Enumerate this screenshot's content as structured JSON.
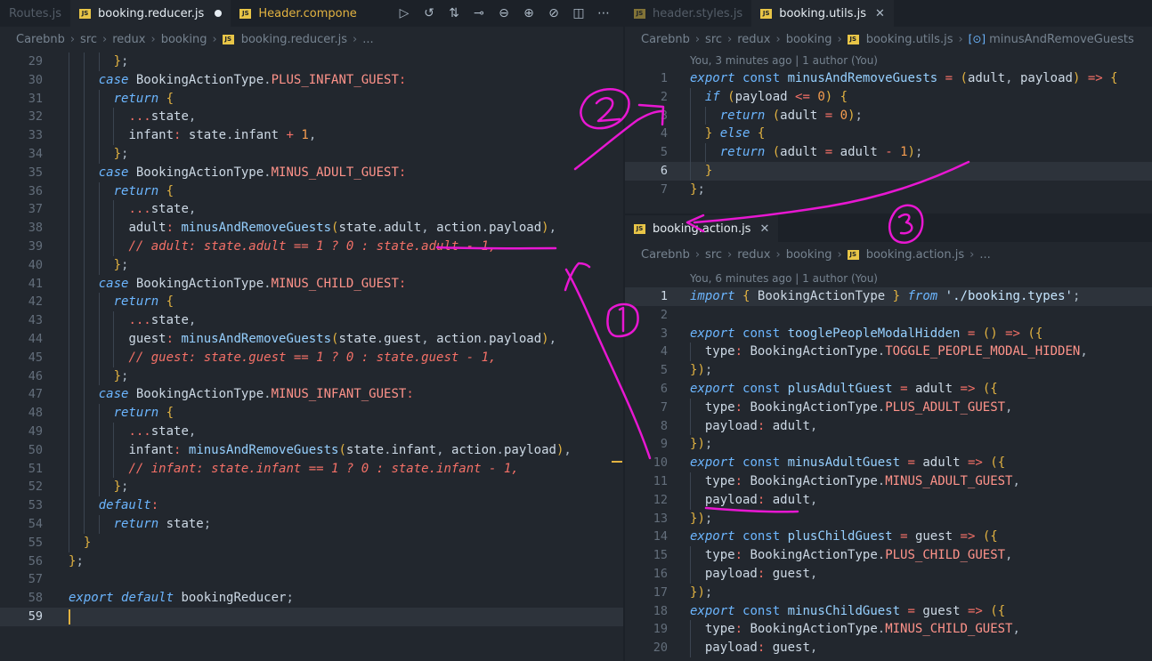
{
  "left_pane": {
    "tabs": [
      {
        "label": "Routes.js",
        "style": "dim"
      },
      {
        "label": "booking.reducer.js",
        "style": "active-modified"
      },
      {
        "label": "Header.compone",
        "style": "yellow"
      }
    ],
    "actions": [
      "run-icon",
      "timeline-icon",
      "compare-icon",
      "git-commit-icon",
      "prev-change-icon",
      "next-change-icon",
      "toggle-icon",
      "split-editor-icon",
      "more-icon"
    ],
    "breadcrumb": [
      "Carebnb",
      "src",
      "redux",
      "booking",
      "booking.reducer.js",
      "..."
    ],
    "lines": [
      {
        "n": "29",
        "t": "      };"
      },
      {
        "n": "30",
        "t": "    case BookingActionType.PLUS_INFANT_GUEST:"
      },
      {
        "n": "31",
        "t": "      return {"
      },
      {
        "n": "32",
        "t": "        ...state,"
      },
      {
        "n": "33",
        "t": "        infant: state.infant + 1,"
      },
      {
        "n": "34",
        "t": "      };"
      },
      {
        "n": "35",
        "t": "    case BookingActionType.MINUS_ADULT_GUEST:"
      },
      {
        "n": "36",
        "t": "      return {"
      },
      {
        "n": "37",
        "t": "        ...state,"
      },
      {
        "n": "38",
        "t": "        adult: minusAndRemoveGuests(state.adult, action.payload),"
      },
      {
        "n": "39",
        "t": "        // adult: state.adult == 1 ? 0 : state.adult - 1,"
      },
      {
        "n": "40",
        "t": "      };"
      },
      {
        "n": "41",
        "t": "    case BookingActionType.MINUS_CHILD_GUEST:"
      },
      {
        "n": "42",
        "t": "      return {"
      },
      {
        "n": "43",
        "t": "        ...state,"
      },
      {
        "n": "44",
        "t": "        guest: minusAndRemoveGuests(state.guest, action.payload),"
      },
      {
        "n": "45",
        "t": "        // guest: state.guest == 1 ? 0 : state.guest - 1,"
      },
      {
        "n": "46",
        "t": "      };"
      },
      {
        "n": "47",
        "t": "    case BookingActionType.MINUS_INFANT_GUEST:"
      },
      {
        "n": "48",
        "t": "      return {"
      },
      {
        "n": "49",
        "t": "        ...state,"
      },
      {
        "n": "50",
        "t": "        infant: minusAndRemoveGuests(state.infant, action.payload),"
      },
      {
        "n": "51",
        "t": "        // infant: state.infant == 1 ? 0 : state.infant - 1,"
      },
      {
        "n": "52",
        "t": "      };"
      },
      {
        "n": "53",
        "t": "    default:"
      },
      {
        "n": "54",
        "t": "      return state;"
      },
      {
        "n": "55",
        "t": "  }"
      },
      {
        "n": "56",
        "t": "};"
      },
      {
        "n": "57",
        "t": ""
      },
      {
        "n": "58",
        "t": "export default bookingReducer;"
      },
      {
        "n": "59",
        "t": ""
      }
    ]
  },
  "right_top_pane": {
    "tabs": [
      {
        "label": "header.styles.js",
        "style": "dim"
      },
      {
        "label": "booking.utils.js",
        "style": "active-close"
      }
    ],
    "breadcrumb": [
      "Carebnb",
      "src",
      "redux",
      "booking",
      "booking.utils.js",
      "minusAndRemoveGuests"
    ],
    "blame": "You, 3 minutes ago | 1 author (You)",
    "lines": [
      {
        "n": "1",
        "t": "export const minusAndRemoveGuests = (adult, payload) => {"
      },
      {
        "n": "2",
        "t": "  if (payload <= 0) {"
      },
      {
        "n": "3",
        "t": "    return (adult = 0);"
      },
      {
        "n": "4",
        "t": "  } else {"
      },
      {
        "n": "5",
        "t": "    return (adult = adult - 1);"
      },
      {
        "n": "6",
        "t": "  }"
      },
      {
        "n": "7",
        "t": "};"
      }
    ]
  },
  "right_bottom_pane": {
    "tabs": [
      {
        "label": "booking.action.js",
        "style": "active-close"
      }
    ],
    "breadcrumb": [
      "Carebnb",
      "src",
      "redux",
      "booking",
      "booking.action.js",
      "..."
    ],
    "blame": "You, 6 minutes ago | 1 author (You)",
    "lines": [
      {
        "n": "1",
        "t": "import { BookingActionType } from './booking.types';"
      },
      {
        "n": "2",
        "t": ""
      },
      {
        "n": "3",
        "t": "export const tooglePeopleModalHidden = () => ({"
      },
      {
        "n": "4",
        "t": "  type: BookingActionType.TOGGLE_PEOPLE_MODAL_HIDDEN,"
      },
      {
        "n": "5",
        "t": "});"
      },
      {
        "n": "6",
        "t": "export const plusAdultGuest = adult => ({"
      },
      {
        "n": "7",
        "t": "  type: BookingActionType.PLUS_ADULT_GUEST,"
      },
      {
        "n": "8",
        "t": "  payload: adult,"
      },
      {
        "n": "9",
        "t": "});"
      },
      {
        "n": "10",
        "t": "export const minusAdultGuest = adult => ({"
      },
      {
        "n": "11",
        "t": "  type: BookingActionType.MINUS_ADULT_GUEST,"
      },
      {
        "n": "12",
        "t": "  payload: adult,"
      },
      {
        "n": "13",
        "t": "});"
      },
      {
        "n": "14",
        "t": "export const plusChildGuest = guest => ({"
      },
      {
        "n": "15",
        "t": "  type: BookingActionType.PLUS_CHILD_GUEST,"
      },
      {
        "n": "16",
        "t": "  payload: guest,"
      },
      {
        "n": "17",
        "t": "});"
      },
      {
        "n": "18",
        "t": "export const minusChildGuest = guest => ({"
      },
      {
        "n": "19",
        "t": "  type: BookingActionType.MINUS_CHILD_GUEST,"
      },
      {
        "n": "20",
        "t": "  payload: guest,"
      }
    ]
  },
  "colors": {
    "accent": "#e8c547",
    "annotation": "#e817d2",
    "background": "#22272e"
  }
}
